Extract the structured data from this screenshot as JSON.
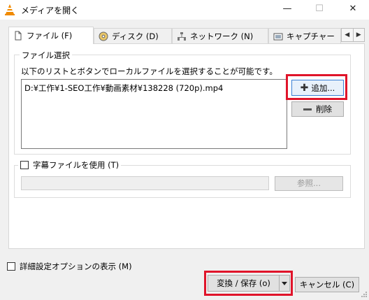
{
  "window": {
    "title": "メディアを開く",
    "minimize_glyph": "—",
    "maximize_glyph": "☐",
    "close_glyph": "✕"
  },
  "tabs": [
    {
      "label": "ファイル (F)",
      "icon": "file-icon"
    },
    {
      "label": "ディスク (D)",
      "icon": "disc-icon"
    },
    {
      "label": "ネットワーク (N)",
      "icon": "network-icon"
    },
    {
      "label": "キャプチャー",
      "icon": "capture-icon"
    }
  ],
  "tab_scroll": {
    "left": "◀",
    "right": "▶"
  },
  "file_group": {
    "legend": "ファイル選択",
    "instruction": "以下のリストとボタンでローカルファイルを選択することが可能です。",
    "files": [
      "D:¥工作¥1-SEO工作¥動画素材¥138228 (720p).mp4"
    ],
    "add_label": "追加...",
    "delete_label": "削除"
  },
  "subtitle_group": {
    "checkbox_label": "字幕ファイルを使用 (T)",
    "browse_label": "参照..."
  },
  "bottom": {
    "advanced_label": "詳細設定オプションの表示 (M)",
    "convert_label": "変換 / 保存 (o)",
    "cancel_label": "キャンセル (C)"
  },
  "colors": {
    "highlight": "#e0142a",
    "vlc_orange": "#f08a00"
  }
}
